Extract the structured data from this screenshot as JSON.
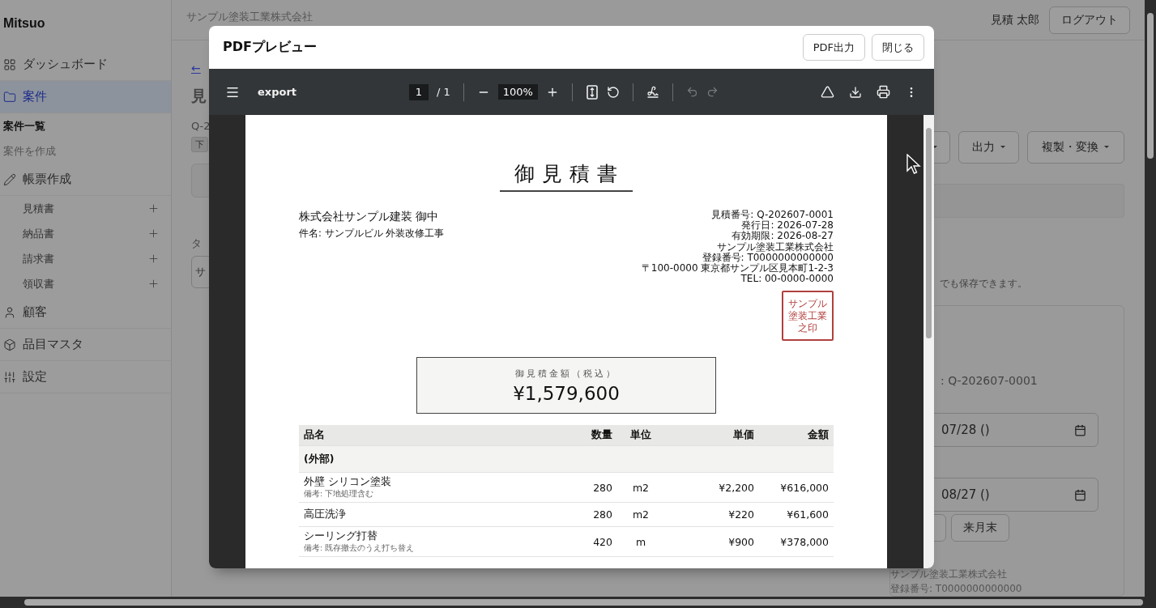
{
  "sidebar": {
    "brand": "Mitsuo",
    "items": [
      {
        "label": "ダッシュボード",
        "selected": false
      },
      {
        "label": "案件",
        "selected": true,
        "children": [
          {
            "kind": "page",
            "label": "案件一覧",
            "selected": true
          },
          {
            "kind": "page",
            "label": "案件を作成",
            "selected": false
          }
        ]
      },
      {
        "label": "帳票作成",
        "selected": false,
        "children": [
          {
            "kind": "create",
            "label": "見積書",
            "selected": false
          },
          {
            "kind": "create",
            "label": "納品書",
            "selected": false
          },
          {
            "kind": "create",
            "label": "請求書",
            "selected": false
          },
          {
            "kind": "create",
            "label": "領収書",
            "selected": false
          }
        ]
      },
      {
        "label": "顧客",
        "selected": false
      },
      {
        "label": "品目マスタ",
        "selected": false
      },
      {
        "label": "設定",
        "selected": false
      }
    ]
  },
  "header": {
    "company": "サンプル塗装工業株式会社",
    "user": "見積 太郎",
    "logout": "ログアウト"
  },
  "page_left": {
    "back_link": "←",
    "heading": "見",
    "number": "Q-2",
    "status_tag": "下",
    "label": "タ",
    "field_value": "サ"
  },
  "page_right": {
    "buttons": [
      "出力",
      "複製・変換"
    ],
    "note": "でも保存できます。",
    "number": ": Q-202607-0001",
    "issue_date": "07/28 ()",
    "expiry_date": "08/27 ()",
    "shortcut_button": "来月末",
    "company": "サンプル塗装工業株式会社",
    "registration": "登録番号: T0000000000000"
  },
  "modal": {
    "title": "PDFプレビュー",
    "buttons": [
      "PDF出力",
      "閉じる"
    ],
    "viewer": {
      "file_name": "export",
      "page": "1",
      "page_count": "/ 1",
      "zoom": "100%",
      "undo": {
        "disabled": true
      },
      "redo": {
        "disabled": true
      }
    },
    "document": {
      "title": "御見積書",
      "recipient": "株式会社サンプル建装 御中",
      "subject": "件名: サンプルビル 外装改修工事",
      "issuer_lines": [
        "見積番号: Q-202607-0001",
        "発行日: 2026-07-28",
        "有効期限: 2026-08-27",
        "サンプル塗装工業株式会社",
        "登録番号: T0000000000000",
        "〒100-0000 東京都サンプル区見本町1-2-3",
        "TEL: 00-0000-0000"
      ],
      "stamp_lines": [
        "サンプル",
        "塗装工業",
        "之印"
      ],
      "total_label": "御見積金額（税込）",
      "total": "¥1,579,600",
      "table": {
        "columns": [
          "品名",
          "数量",
          "単位",
          "単価",
          "金額"
        ],
        "rows": [
          {
            "kind": "section",
            "name": "(外部)"
          },
          {
            "kind": "item",
            "name": "外壁 シリコン塗装",
            "note": "備考: 下地処理含む",
            "quantity": "280",
            "unit": "m2",
            "unit_price": "¥2,200",
            "amount": "¥616,000"
          },
          {
            "kind": "item",
            "name": "高圧洗浄",
            "quantity": "280",
            "unit": "m2",
            "unit_price": "¥220",
            "amount": "¥61,600"
          },
          {
            "kind": "item",
            "name": "シーリング打替",
            "note": "備考: 既存撤去のうえ打ち替え",
            "quantity": "420",
            "unit": "m",
            "unit_price": "¥900",
            "amount": "¥378,000"
          }
        ]
      }
    }
  }
}
